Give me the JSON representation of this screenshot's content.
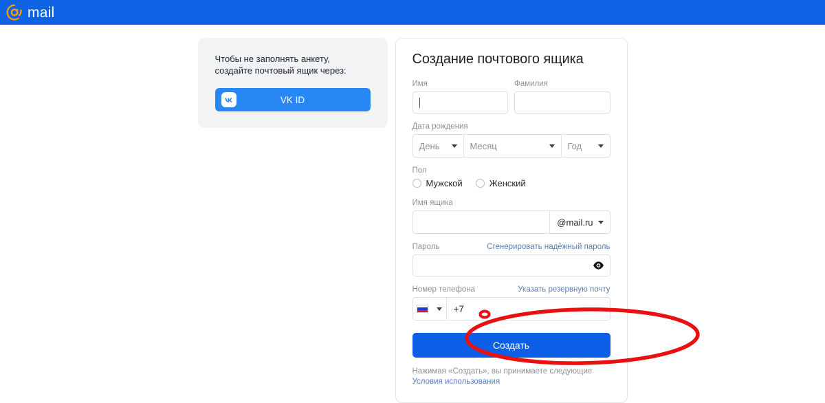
{
  "header": {
    "logo_icon": "at-sign-icon",
    "logo_text": "mail",
    "brand_color": "#0D63E4",
    "logo_accent_color": "#FF9E00"
  },
  "social_card": {
    "prompt": "Чтобы не заполнять анкету, создайте почтовый ящик через:",
    "vk_button_label": "VK ID",
    "vk_icon": "vk-logo-icon",
    "vk_color": "#2787F5",
    "card_bg": "#F2F3F5"
  },
  "form": {
    "title": "Создание почтового ящика",
    "first_name": {
      "label": "Имя",
      "value": "",
      "placeholder": "",
      "focused": true
    },
    "last_name": {
      "label": "Фамилия",
      "value": "",
      "placeholder": ""
    },
    "birth_date": {
      "label": "Дата рождения",
      "day": "День",
      "month": "Месяц",
      "year": "Год",
      "chevron_icon": "chevron-down-icon"
    },
    "gender": {
      "label": "Пол",
      "options": [
        {
          "label": "Мужской",
          "selected": false
        },
        {
          "label": "Женский",
          "selected": false
        }
      ]
    },
    "mailbox": {
      "label": "Имя ящика",
      "value": "",
      "domain": "@mail.ru",
      "domain_chevron_icon": "chevron-down-icon"
    },
    "password": {
      "label": "Пароль",
      "value": "",
      "generate_link": "Сгенерировать надёжный пароль",
      "reveal_icon": "eye-icon"
    },
    "phone": {
      "label": "Номер телефона",
      "backup_email_link": "Указать резервную почту",
      "country_flag_icon": "russia-flag-icon",
      "country_chevron_icon": "chevron-down-icon",
      "prefix": "+7",
      "value": ""
    },
    "submit_label": "Создать",
    "submit_color": "#0D5FE8",
    "terms_prefix": "Нажимая «Создать», вы принимаете следующие ",
    "terms_link": "Условия использования",
    "link_color": "#5880B8"
  },
  "annotation": {
    "type": "hand-drawn-ellipse",
    "color": "#E81010",
    "target": "submit-button"
  }
}
